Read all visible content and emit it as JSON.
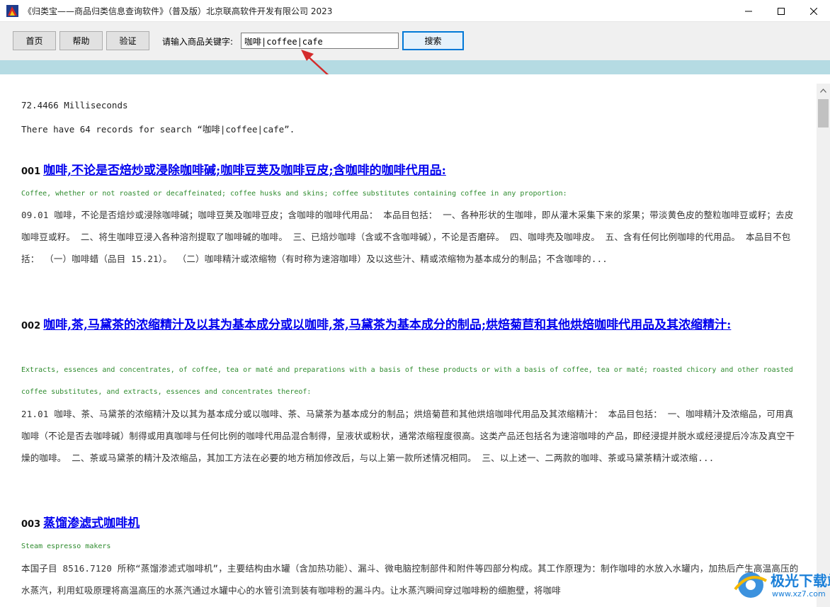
{
  "window": {
    "title": "《归类宝——商品归类信息查询软件》（普及版）北京联高软件开发有限公司 2023",
    "icon": "app-logo-icon"
  },
  "toolbar": {
    "home_label": "首页",
    "help_label": "帮助",
    "verify_label": "验证",
    "search_label": "请输入商品关键字:",
    "search_value": "咖啡|coffee|cafe",
    "search_button": "搜索"
  },
  "results": {
    "time": "72.4466 Milliseconds",
    "summary": "There have 64 records for search “咖啡|coffee|cafe”.",
    "entries": [
      {
        "num": "001",
        "title": "咖啡,不论是否焙炒或浸除咖啡碱;咖啡豆荚及咖啡豆皮;含咖啡的咖啡代用品:",
        "en": "Coffee, whether or not roasted or decaffeinated; coffee husks and skins; coffee substitutes containing coffee in any proportion:",
        "desc": "09.01 咖啡，不论是否焙炒或浸除咖啡碱；咖啡豆荚及咖啡豆皮；含咖啡的咖啡代用品： 本品目包括： 一、各种形状的生咖啡，即从灌木采集下来的浆果；带淡黄色皮的整粒咖啡豆或籽；去皮咖啡豆或籽。 二、将生咖啡豆浸入各种溶剂提取了咖啡碱的咖啡。 三、已焙炒咖啡（含或不含咖啡碱），不论是否磨碎。 四、咖啡壳及咖啡皮。 五、含有任何比例咖啡的代用品。 本品目不包括： （一）咖啡蜡（品目 15.21）。 （二）咖啡精汁或浓缩物（有时称为速溶咖啡）及以这些汁、精或浓缩物为基本成分的制品；不含咖啡的..."
      },
      {
        "num": "002",
        "title": "咖啡,茶,马黛茶的浓缩精汁及以其为基本成分或以咖啡,茶,马黛茶为基本成分的制品;烘焙菊苣和其他烘焙咖啡代用品及其浓缩精汁:",
        "en": "Extracts, essences and concentrates, of coffee, tea or maté and preparations with a basis of these products or with a basis of coffee, tea or maté; roasted chicory and other roasted coffee substitutes, and extracts, essences and concentrates thereof:",
        "desc": "21.01 咖啡、茶、马黛茶的浓缩精汁及以其为基本成分或以咖啡、茶、马黛茶为基本成分的制品；烘焙菊苣和其他烘焙咖啡代用品及其浓缩精汁： 本品目包括： 一、咖啡精汁及浓缩品，可用真咖啡（不论是否去咖啡碱）制得或用真咖啡与任何比例的咖啡代用品混合制得，呈液状或粉状，通常浓缩程度很高。这类产品还包括名为速溶咖啡的产品，即经浸提并脱水或经浸提后冷冻及真空干燥的咖啡。 二、茶或马黛茶的精汁及浓缩品，其加工方法在必要的地方稍加修改后，与以上第一款所述情况相同。 三、以上述一、二两款的咖啡、茶或马黛茶精汁或浓缩..."
      },
      {
        "num": "003",
        "title": "蒸馏渗滤式咖啡机",
        "en": "Steam espresso makers",
        "desc": "本国子目 8516.7120 所称“蒸馏渗滤式咖啡机”，主要结构由水罐（含加热功能）、漏斗、微电脑控制部件和附件等四部分构成。其工作原理为：制作咖啡的水放入水罐内，加热后产生高温高压的水蒸汽，利用虹吸原理将高温高压的水蒸汽通过水罐中心的水管引流到装有咖啡粉的漏斗内。让水蒸汽瞬间穿过咖啡粉的细胞壁，将咖啡"
      }
    ]
  },
  "watermark": {
    "text": "极光下载站",
    "url": "www.xz7.com"
  }
}
